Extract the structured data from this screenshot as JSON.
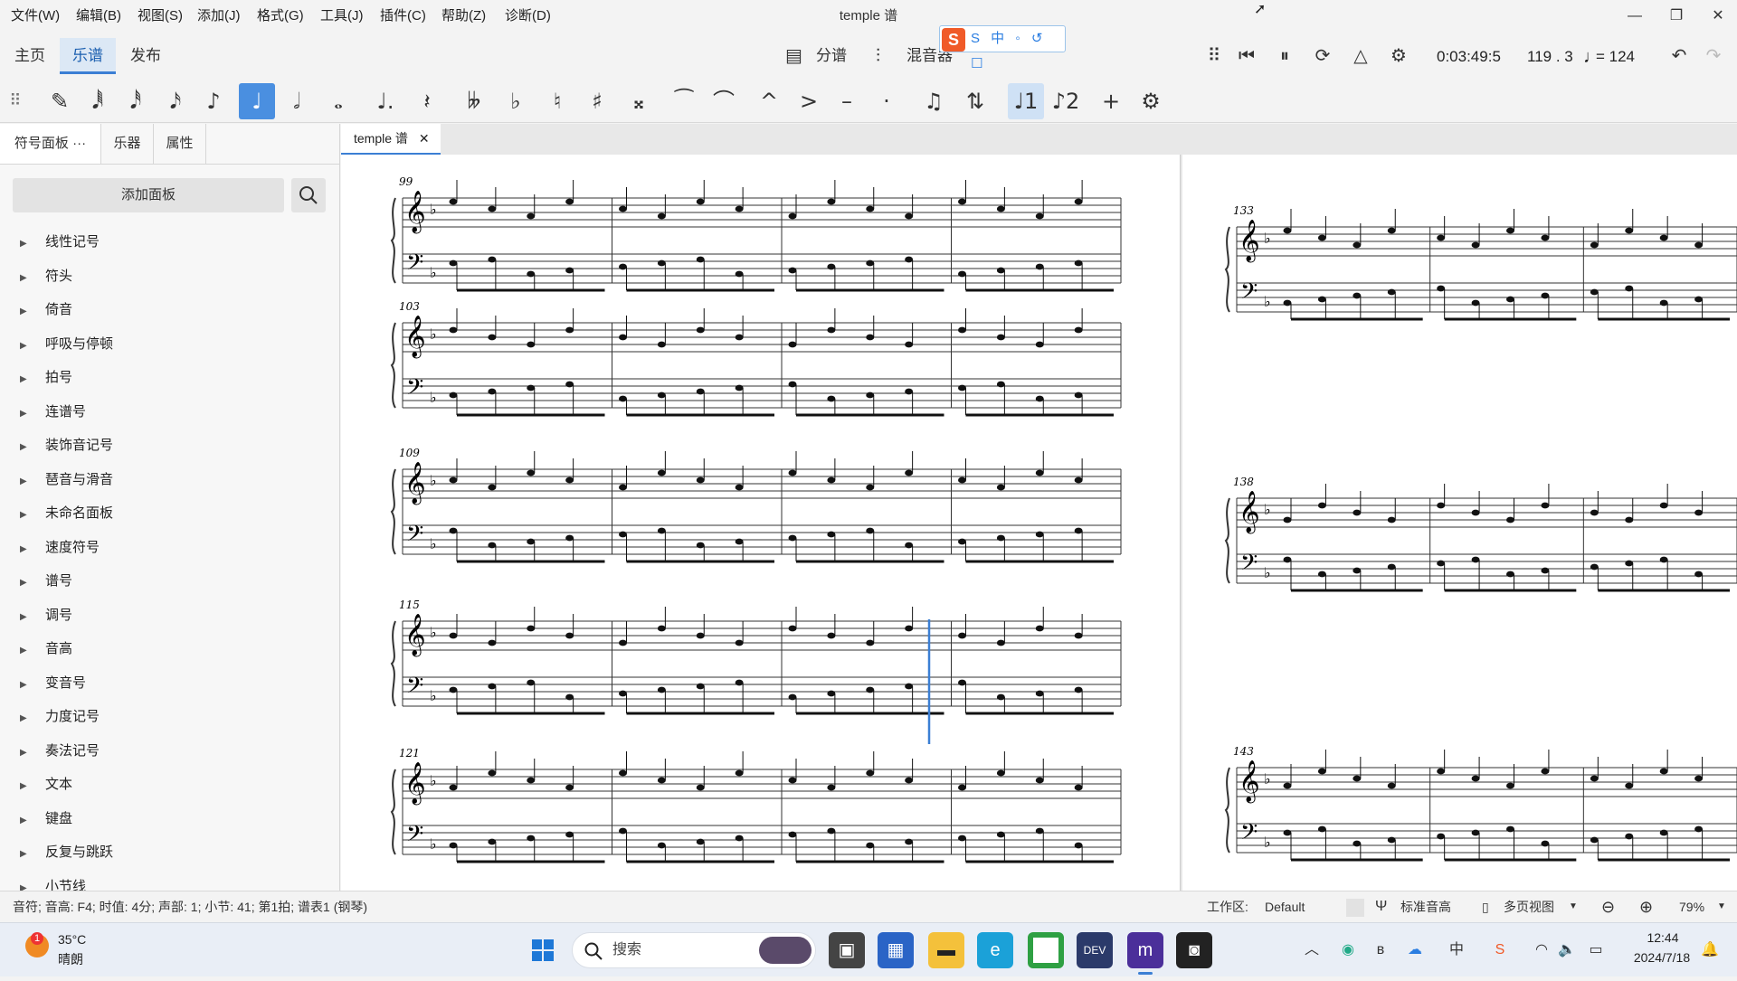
{
  "titlebar": {
    "menus": [
      "文件(W)",
      "编辑(B)",
      "视图(S)",
      "添加(J)",
      "格式(G)",
      "工具(J)",
      "插件(C)",
      "帮助(Z)",
      "诊断(D)"
    ],
    "title": "temple 谱",
    "ime_badge": "S 中 ◦ ↺ ☐"
  },
  "tabs": {
    "home": "主页",
    "score": "乐谱",
    "publish": "发布"
  },
  "center": {
    "parts": "分谱",
    "mixer": "混音器"
  },
  "playback": {
    "time": "0:03:49:5",
    "position": "119 . 3",
    "tempo": "= 124"
  },
  "palette_tools": [
    {
      "name": "pencil",
      "glyph": "✎"
    },
    {
      "name": "64th-note",
      "glyph": "𝅘𝅥𝅱"
    },
    {
      "name": "32nd-note",
      "glyph": "𝅘𝅥𝅰"
    },
    {
      "name": "16th-note",
      "glyph": "𝅘𝅥𝅯"
    },
    {
      "name": "eighth-note",
      "glyph": "♪"
    },
    {
      "name": "quarter-note",
      "glyph": "♩"
    },
    {
      "name": "half-note",
      "glyph": "𝅗𝅥"
    },
    {
      "name": "whole-note",
      "glyph": "𝅝"
    },
    {
      "name": "augmentation-dot",
      "glyph": "♩."
    },
    {
      "name": "rest",
      "glyph": "𝄽"
    },
    {
      "name": "double-flat",
      "glyph": "𝄫"
    },
    {
      "name": "flat",
      "glyph": "♭"
    },
    {
      "name": "natural",
      "glyph": "♮"
    },
    {
      "name": "sharp",
      "glyph": "♯"
    },
    {
      "name": "double-sharp",
      "glyph": "𝄪"
    },
    {
      "name": "tie",
      "glyph": "⁀"
    },
    {
      "name": "slur",
      "glyph": "⌒"
    },
    {
      "name": "marcato",
      "glyph": "^"
    },
    {
      "name": "accent",
      "glyph": ">"
    },
    {
      "name": "tenuto",
      "glyph": "–"
    },
    {
      "name": "staccato",
      "glyph": "·"
    },
    {
      "name": "tuplet",
      "glyph": "♫"
    },
    {
      "name": "flip-direction",
      "glyph": "⇅"
    },
    {
      "name": "voice-1",
      "glyph": "♩1"
    },
    {
      "name": "voice-2",
      "glyph": "♪2"
    },
    {
      "name": "add",
      "glyph": "+"
    },
    {
      "name": "settings",
      "glyph": "⚙"
    }
  ],
  "left_panel": {
    "tabs": [
      "符号面板 ···",
      "乐器",
      "属性"
    ],
    "add_button": "添加面板",
    "items": [
      "线性记号",
      "符头",
      "倚音",
      "呼吸与停顿",
      "拍号",
      "连谱号",
      "装饰音记号",
      "琶音与滑音",
      "未命名面板",
      "速度符号",
      "谱号",
      "调号",
      "音高",
      "变音号",
      "力度记号",
      "奏法记号",
      "文本",
      "键盘",
      "反复与跳跃",
      "小节线"
    ]
  },
  "document_tab": "temple 谱",
  "score": {
    "page1_system_numbers": [
      "99",
      "103",
      "109",
      "115",
      "121"
    ],
    "page2_system_numbers": [
      "133",
      "138",
      "143"
    ]
  },
  "statusbar": {
    "info": "音符; 音高: F4; 时值: 4分; 声部: 1; 小节: 41; 第1拍; 谱表1 (钢琴)",
    "workspace_label": "工作区:",
    "workspace_value": "Default",
    "concert_pitch": "标准音高",
    "view_mode": "多页视图",
    "zoom": "79%"
  },
  "taskbar": {
    "weather_temp": "35°C",
    "weather_desc": "晴朗",
    "search": "搜索",
    "time": "12:44",
    "date": "2024/7/18"
  }
}
